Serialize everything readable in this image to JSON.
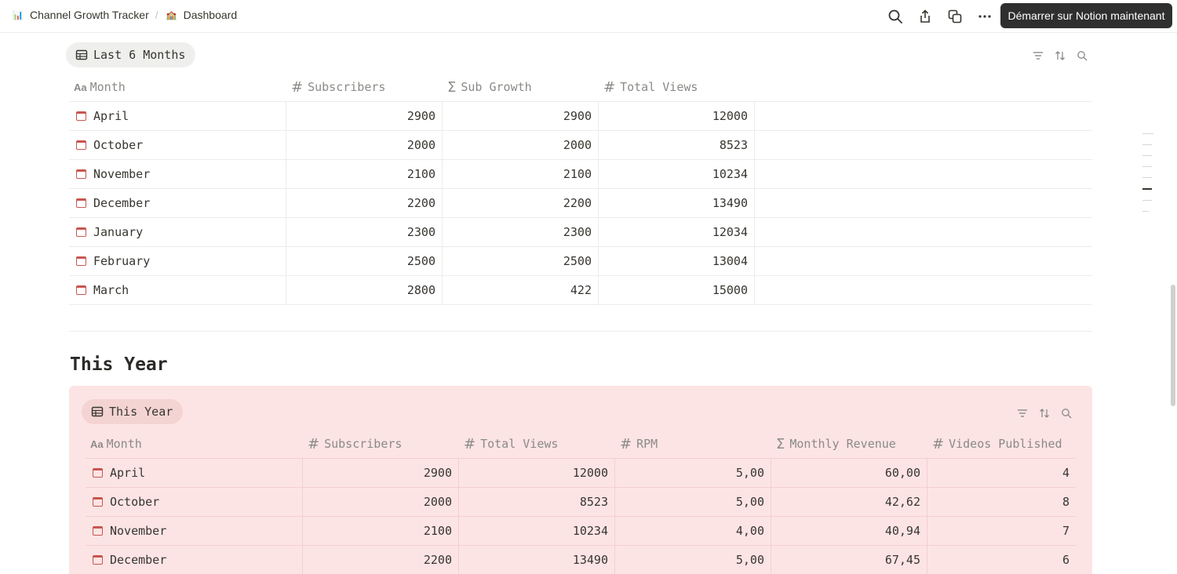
{
  "breadcrumb": {
    "workspace": {
      "icon": "📊",
      "label": "Channel Growth Tracker"
    },
    "separator": "/",
    "page": {
      "icon": "🏫",
      "label": "Dashboard"
    }
  },
  "topbar": {
    "cta_label": "Démarrer sur Notion maintenant",
    "icons": [
      "search-icon",
      "share-icon",
      "duplicate-icon",
      "more-icon"
    ]
  },
  "last6": {
    "view_label": "Last 6 Months",
    "columns": [
      {
        "icon": "Aa",
        "label": "Month"
      },
      {
        "icon": "#",
        "label": "Subscribers"
      },
      {
        "icon": "Σ",
        "label": "Sub Growth"
      },
      {
        "icon": "#",
        "label": "Total Views"
      }
    ],
    "rows": [
      {
        "month": "April",
        "subscribers": "2900",
        "sub_growth": "2900",
        "total_views": "12000"
      },
      {
        "month": "October",
        "subscribers": "2000",
        "sub_growth": "2000",
        "total_views": "8523"
      },
      {
        "month": "November",
        "subscribers": "2100",
        "sub_growth": "2100",
        "total_views": "10234"
      },
      {
        "month": "December",
        "subscribers": "2200",
        "sub_growth": "2200",
        "total_views": "13490"
      },
      {
        "month": "January",
        "subscribers": "2300",
        "sub_growth": "2300",
        "total_views": "12034"
      },
      {
        "month": "February",
        "subscribers": "2500",
        "sub_growth": "2500",
        "total_views": "13004"
      },
      {
        "month": "March",
        "subscribers": "2800",
        "sub_growth": "422",
        "total_views": "15000"
      }
    ]
  },
  "this_year": {
    "heading": "This Year",
    "view_label": "This Year",
    "columns": [
      {
        "icon": "Aa",
        "label": "Month"
      },
      {
        "icon": "#",
        "label": "Subscribers"
      },
      {
        "icon": "#",
        "label": "Total Views"
      },
      {
        "icon": "#",
        "label": "RPM"
      },
      {
        "icon": "Σ",
        "label": "Monthly Revenue"
      },
      {
        "icon": "#",
        "label": "Videos Published"
      }
    ],
    "rows": [
      {
        "month": "April",
        "subscribers": "2900",
        "total_views": "12000",
        "rpm": "5,00",
        "revenue": "60,00",
        "videos": "4"
      },
      {
        "month": "October",
        "subscribers": "2000",
        "total_views": "8523",
        "rpm": "5,00",
        "revenue": "42,62",
        "videos": "8"
      },
      {
        "month": "November",
        "subscribers": "2100",
        "total_views": "10234",
        "rpm": "4,00",
        "revenue": "40,94",
        "videos": "7"
      },
      {
        "month": "December",
        "subscribers": "2200",
        "total_views": "13490",
        "rpm": "5,00",
        "revenue": "67,45",
        "videos": "6"
      }
    ]
  },
  "colors": {
    "accent_background": "#fde4e4",
    "cta_background": "#2f2f2f",
    "text": "#37352f"
  }
}
